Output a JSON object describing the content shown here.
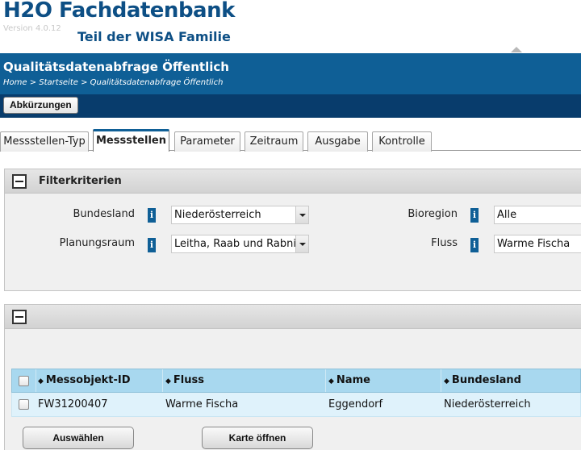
{
  "app": {
    "title": "H2O Fachdatenbank",
    "version": "Version 4.0.12",
    "subtitle": "Teil der WISA Familie"
  },
  "header": {
    "title": "Qualitätsdatenabfrage Öffentlich",
    "breadcrumb": "Home > Startseite > Qualitätsdatenabfrage Öffentlich"
  },
  "toolbar": {
    "abbreviations_label": "Abkürzungen"
  },
  "tabs": [
    {
      "label": "Messstellen-Typ",
      "active": false
    },
    {
      "label": "Messstellen",
      "active": true
    },
    {
      "label": "Parameter",
      "active": false
    },
    {
      "label": "Zeitraum",
      "active": false
    },
    {
      "label": "Ausgabe",
      "active": false
    },
    {
      "label": "Kontrolle",
      "active": false
    }
  ],
  "filter": {
    "title": "Filterkriterien",
    "info_glyph": "i",
    "fields": {
      "bundesland": {
        "label": "Bundesland",
        "value": "Niederösterreich"
      },
      "planungsraum": {
        "label": "Planungsraum",
        "value": "Leitha, Raab und Rabnitz"
      },
      "bioregion": {
        "label": "Bioregion",
        "value": "Alle"
      },
      "fluss": {
        "label": "Fluss",
        "value": "Warme Fischa"
      }
    }
  },
  "results": {
    "sort_glyph": "◆",
    "columns": [
      "Messobjekt-ID",
      "Fluss",
      "Name",
      "Bundesland"
    ],
    "rows": [
      [
        "FW31200407",
        "Warme Fischa",
        "Eggendorf",
        "Niederösterreich"
      ]
    ]
  },
  "buttons": {
    "select_label": "Auswählen",
    "map_label": "Karte öffnen"
  },
  "colors": {
    "brand_blue": "#0d4f85",
    "header_bg": "#0f5f96",
    "toolbar_bg": "#083c6c",
    "grid_header_bg": "#a8d8ef",
    "grid_row_bg": "#dff2fb"
  }
}
